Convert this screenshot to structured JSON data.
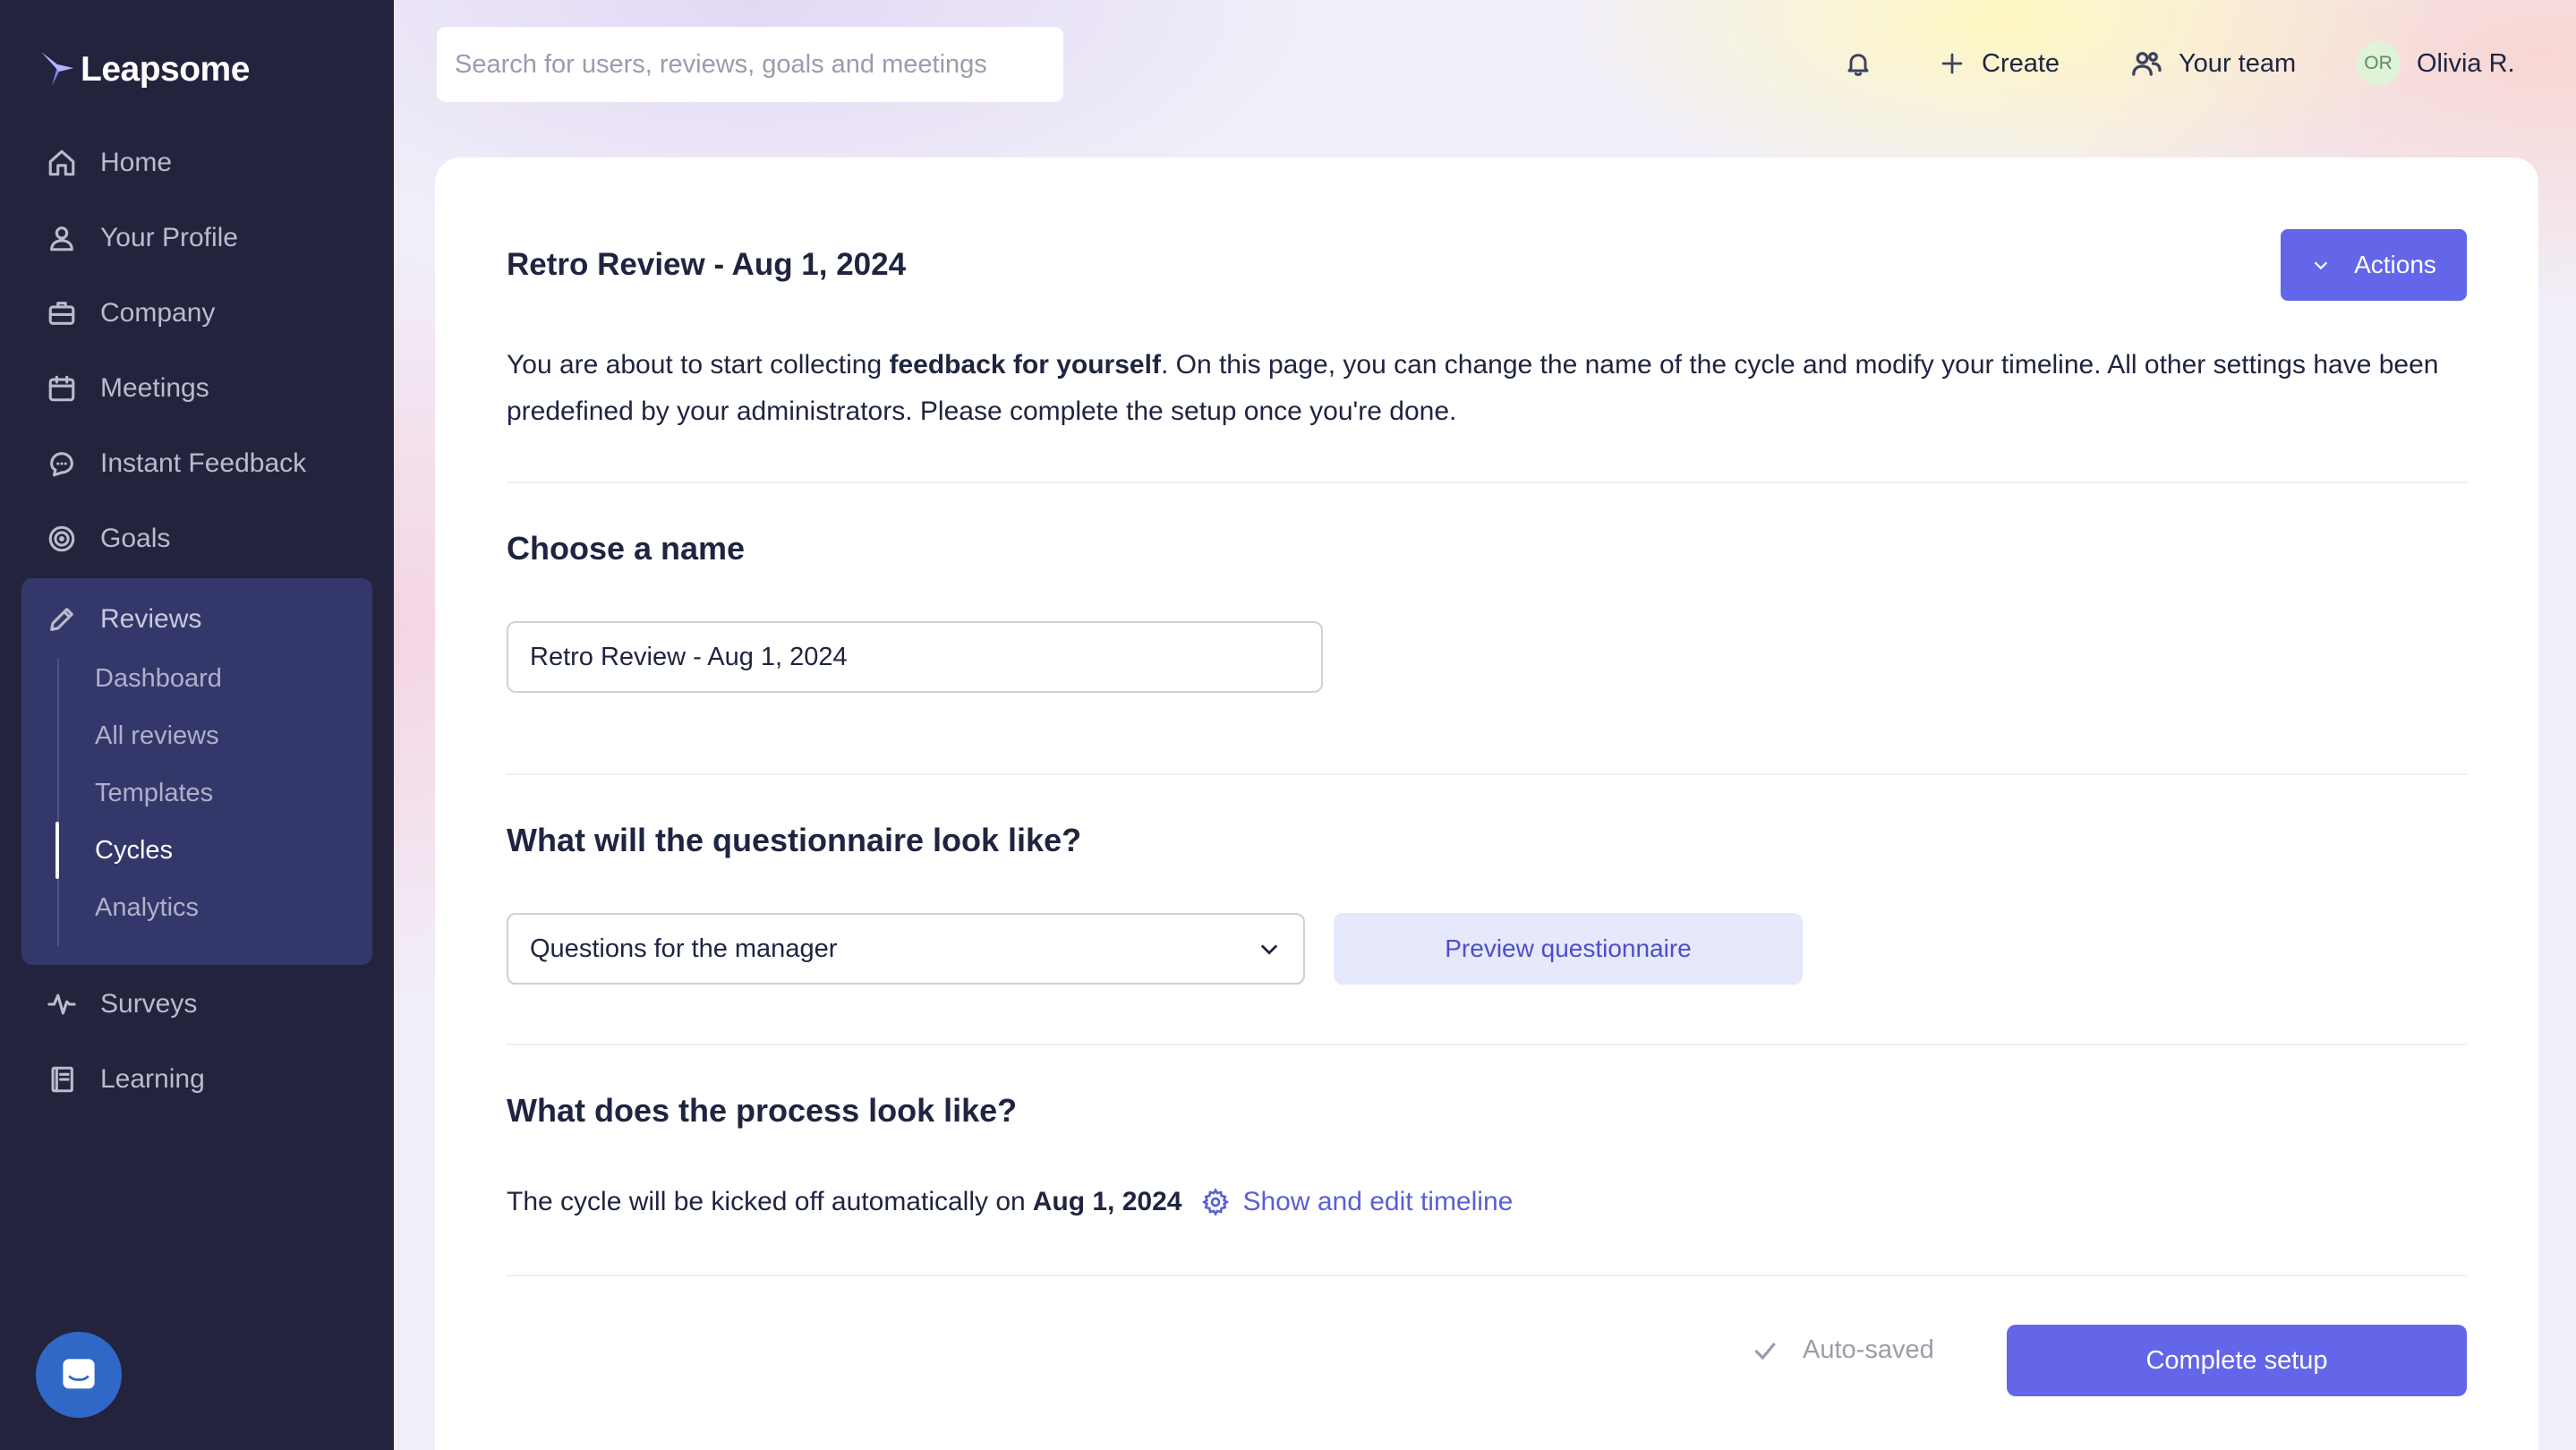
{
  "app": {
    "brand": "Leapsome"
  },
  "sidebar": {
    "items": [
      {
        "label": "Home",
        "icon": "home-icon"
      },
      {
        "label": "Your Profile",
        "icon": "user-icon"
      },
      {
        "label": "Company",
        "icon": "briefcase-icon"
      },
      {
        "label": "Meetings",
        "icon": "calendar-icon"
      },
      {
        "label": "Instant Feedback",
        "icon": "chat-icon"
      },
      {
        "label": "Goals",
        "icon": "target-icon"
      },
      {
        "label": "Reviews",
        "icon": "pencil-icon"
      },
      {
        "label": "Surveys",
        "icon": "pulse-icon"
      },
      {
        "label": "Learning",
        "icon": "book-icon"
      }
    ],
    "reviews_subnav": [
      {
        "label": "Dashboard"
      },
      {
        "label": "All reviews"
      },
      {
        "label": "Templates"
      },
      {
        "label": "Cycles",
        "active": true
      },
      {
        "label": "Analytics"
      }
    ]
  },
  "topbar": {
    "search_placeholder": "Search for users, reviews, goals and meetings",
    "create_label": "Create",
    "team_label": "Your team",
    "user_initials": "OR",
    "user_name": "Olivia R."
  },
  "card": {
    "title": "Retro Review - Aug 1, 2024",
    "actions_label": "Actions",
    "intro_before": "You are about to start collecting ",
    "intro_bold": "feedback for yourself",
    "intro_after": ". On this page, you can change the name of the cycle and modify your timeline. All other settings have been predefined by your administrators. Please complete the setup once you're done.",
    "name_section": {
      "title": "Choose a name",
      "value": "Retro Review - Aug 1, 2024"
    },
    "questionnaire_section": {
      "title": "What will the questionnaire look like?",
      "selected": "Questions for the manager",
      "preview_label": "Preview questionnaire"
    },
    "process_section": {
      "title": "What does the process look like?",
      "text_before": "The cycle will be kicked off automatically on",
      "date": "Aug 1, 2024",
      "link_label": "Show and edit timeline"
    },
    "footer": {
      "status": "Auto-saved",
      "complete_label": "Complete setup"
    }
  },
  "colors": {
    "sidebar_bg": "#23233d",
    "reviews_group_bg": "#34376a",
    "accent": "#6366e8",
    "link": "#5a5fd6"
  }
}
